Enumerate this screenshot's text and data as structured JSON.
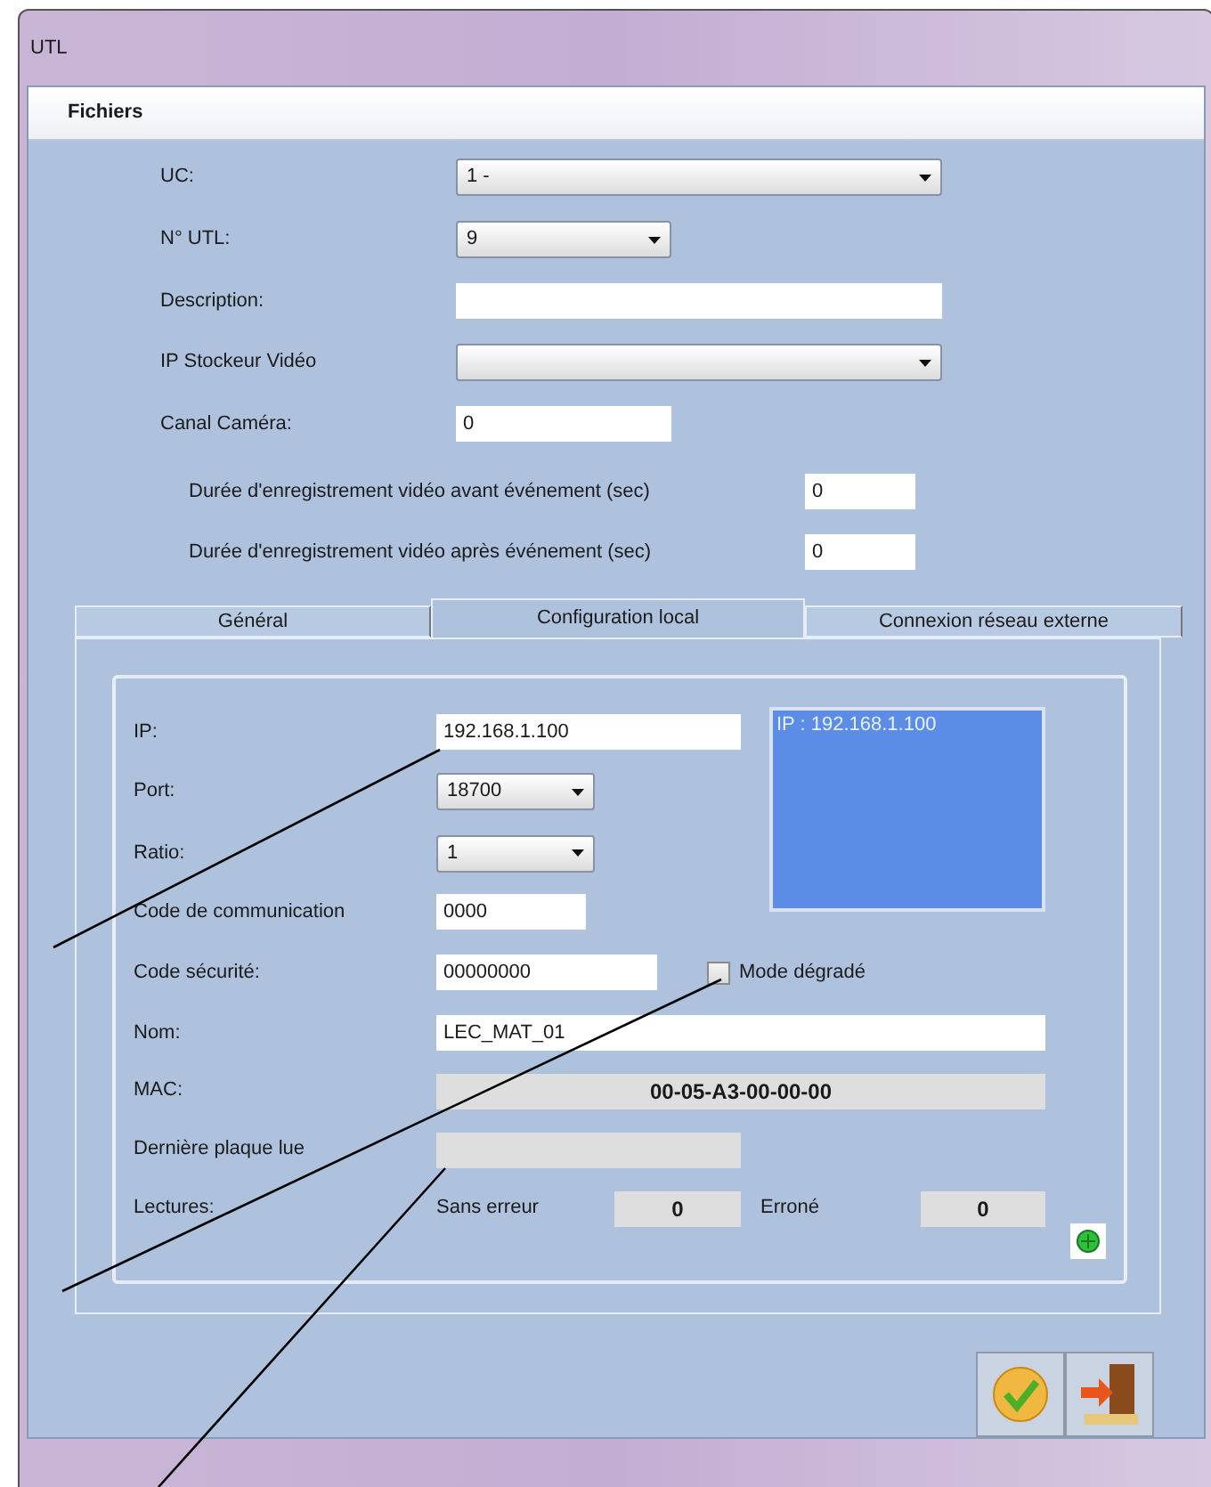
{
  "window": {
    "title": "UTL"
  },
  "menu": [
    "Fichiers"
  ],
  "form": [
    {
      "kind": "combo",
      "label": "UC:",
      "value": "1 -"
    },
    {
      "kind": "combo",
      "label": "N° UTL:",
      "value": "9"
    },
    {
      "kind": "input",
      "label": "Description:"
    },
    {
      "kind": "combo",
      "label": "IP Stockeur Vidéo"
    },
    {
      "kind": "input",
      "label": "Canal Caméra:",
      "value": "0"
    }
  ],
  "durations": [
    {
      "label": "Durée d'enregistrement vidéo avant événement (sec)",
      "value": "0"
    },
    {
      "label": "Durée d'enregistrement vidéo après événement (sec)",
      "value": "0"
    }
  ],
  "tabs": [
    {
      "label": "Général",
      "selected": false
    },
    {
      "label": "Configuration local",
      "selected": true
    },
    {
      "label": "Connexion réseau externe",
      "selected": false
    }
  ],
  "config": {
    "ip": {
      "label": "IP:",
      "value": "192.168.1.100"
    },
    "ip_list": [
      "IP : 192.168.1.100"
    ],
    "port": {
      "label": "Port:",
      "value": "18700"
    },
    "ratio": {
      "label": "Ratio:",
      "value": "1"
    },
    "code_communication": {
      "label": "Code de communication",
      "value": "0000"
    },
    "code_securite": {
      "label": "Code sécurité:",
      "value": "00000000"
    },
    "mode_degrade": {
      "label": "Mode dégradé",
      "checked": false
    },
    "nom": {
      "label": "Nom:",
      "value": "LEC_MAT_01"
    },
    "mac": {
      "label": "MAC:",
      "value": "00-05-A3-00-00-00"
    },
    "derniere_plaque": {
      "label": "Dernière plaque lue"
    },
    "lectures": {
      "label": "Lectures:",
      "ok_label": "Sans erreur",
      "ok_value": "0",
      "err_label": "Erroné",
      "err_value": "0"
    }
  }
}
